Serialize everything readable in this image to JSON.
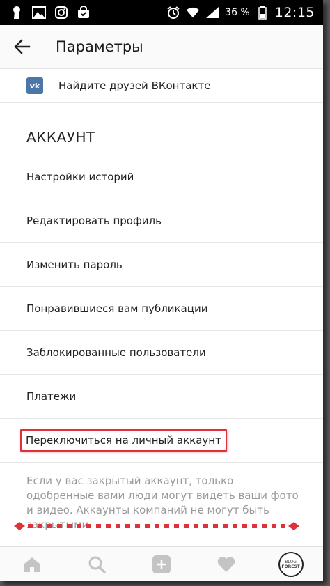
{
  "status_bar": {
    "battery_percent": "36 %",
    "time": "12:15",
    "left_icons": [
      "keyhole-icon",
      "image-icon",
      "instagram-icon",
      "bag-icon"
    ],
    "right_icons": [
      "alarm-icon",
      "wifi-icon",
      "signal-icon",
      "battery-icon"
    ]
  },
  "header": {
    "title": "Параметры",
    "back_icon": "arrow-left-icon"
  },
  "vk_row": {
    "logo_text": "vk",
    "label": "Найдите друзей ВКонтакте"
  },
  "section": {
    "title": "АККАУНТ"
  },
  "items": [
    {
      "label": "Настройки историй"
    },
    {
      "label": "Редактировать профиль"
    },
    {
      "label": "Изменить пароль"
    },
    {
      "label": "Понравившиеся вам публикации"
    },
    {
      "label": "Заблокированные пользователи"
    },
    {
      "label": "Платежи"
    },
    {
      "label": "Переключиться на личный аккаунт",
      "highlighted": true
    }
  ],
  "note": "Если у вас закрытый аккаунт, только одобренные вами люди могут видеть ваши фото и видео. Аккаунты компаний не могут быть закрытыми.",
  "annotation": {
    "color": "#e0303a"
  },
  "bottom_nav": {
    "items": [
      "home-icon",
      "search-icon",
      "add-icon",
      "heart-icon",
      "profile-avatar"
    ],
    "avatar_text_top": "BLOG",
    "avatar_text_bottom": "FOREST"
  }
}
